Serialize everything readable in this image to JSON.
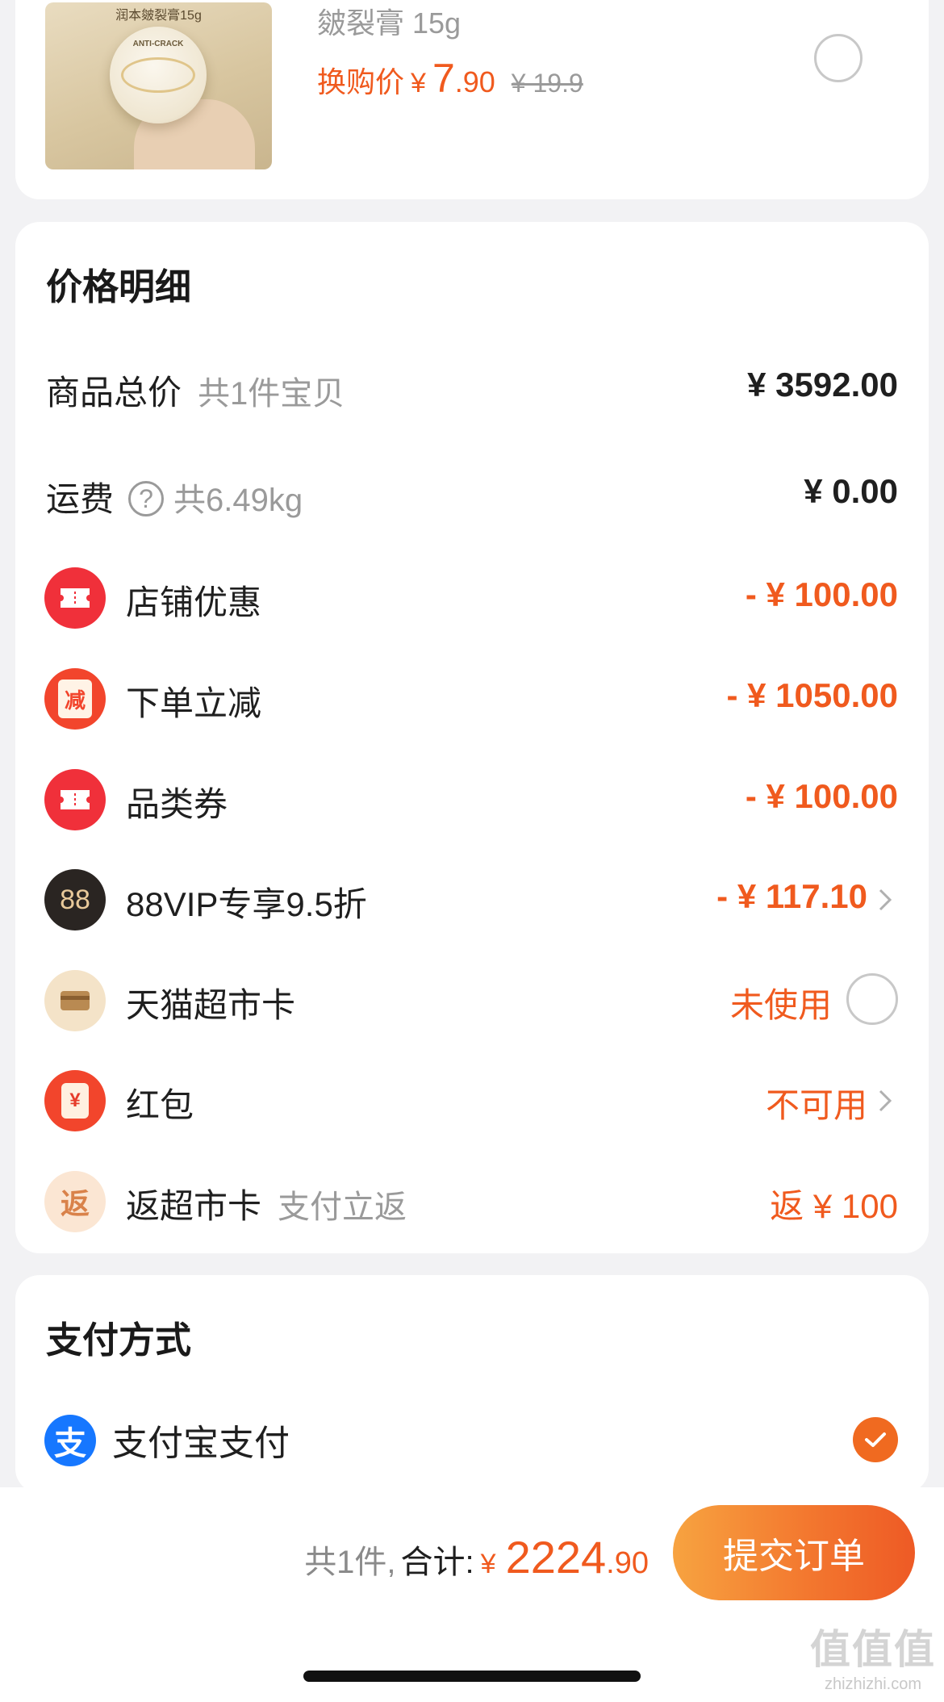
{
  "product": {
    "thumb_label": "润本皴裂膏15g",
    "thumb_jar_text": "ANTI-CRACK",
    "name": "皴裂膏 15g",
    "price_label": "换购价",
    "price_yen": "¥",
    "price_int": "7",
    "price_dec": ".90",
    "original_price": "¥ 19.9"
  },
  "price_detail": {
    "title": "价格明细",
    "rows": [
      {
        "label": "商品总价",
        "sub": "共1件宝贝",
        "value": "¥ 3592.00"
      },
      {
        "label": "运费",
        "sub": "共6.49kg",
        "value": "¥ 0.00"
      },
      {
        "label": "店铺优惠",
        "value": "- ¥ 100.00",
        "icon": "ticket-icon"
      },
      {
        "label": "下单立减",
        "value": "- ¥ 1050.00",
        "icon": "reduce-icon",
        "icon_text": "减"
      },
      {
        "label": "品类券",
        "value": "- ¥ 100.00",
        "icon": "ticket-icon"
      },
      {
        "label": "88VIP专享9.5折",
        "value": "- ¥ 117.10",
        "icon": "88vip-icon",
        "icon_text": "88"
      },
      {
        "label": "天猫超市卡",
        "value": "未使用",
        "icon": "card-icon"
      },
      {
        "label": "红包",
        "value": "不可用",
        "icon": "red-packet-icon",
        "icon_text": "¥"
      },
      {
        "label": "返超市卡",
        "sub": "支付立返",
        "value": "返 ¥ 100",
        "icon": "return-icon",
        "icon_text": "返"
      }
    ]
  },
  "payment": {
    "title": "支付方式",
    "method": "支付宝支付",
    "method_icon_text": "支"
  },
  "bottom_bar": {
    "count": "共1件,",
    "total_label": "合计:",
    "total_yen": "¥",
    "total_int": "2224",
    "total_dec": ".90",
    "submit": "提交订单"
  },
  "watermark": {
    "big": "值值值",
    "small": "zhizhizhi.com"
  },
  "colors": {
    "accent": "#f05a1e",
    "muted": "#9a9a9a",
    "alipay": "#1677ff"
  }
}
